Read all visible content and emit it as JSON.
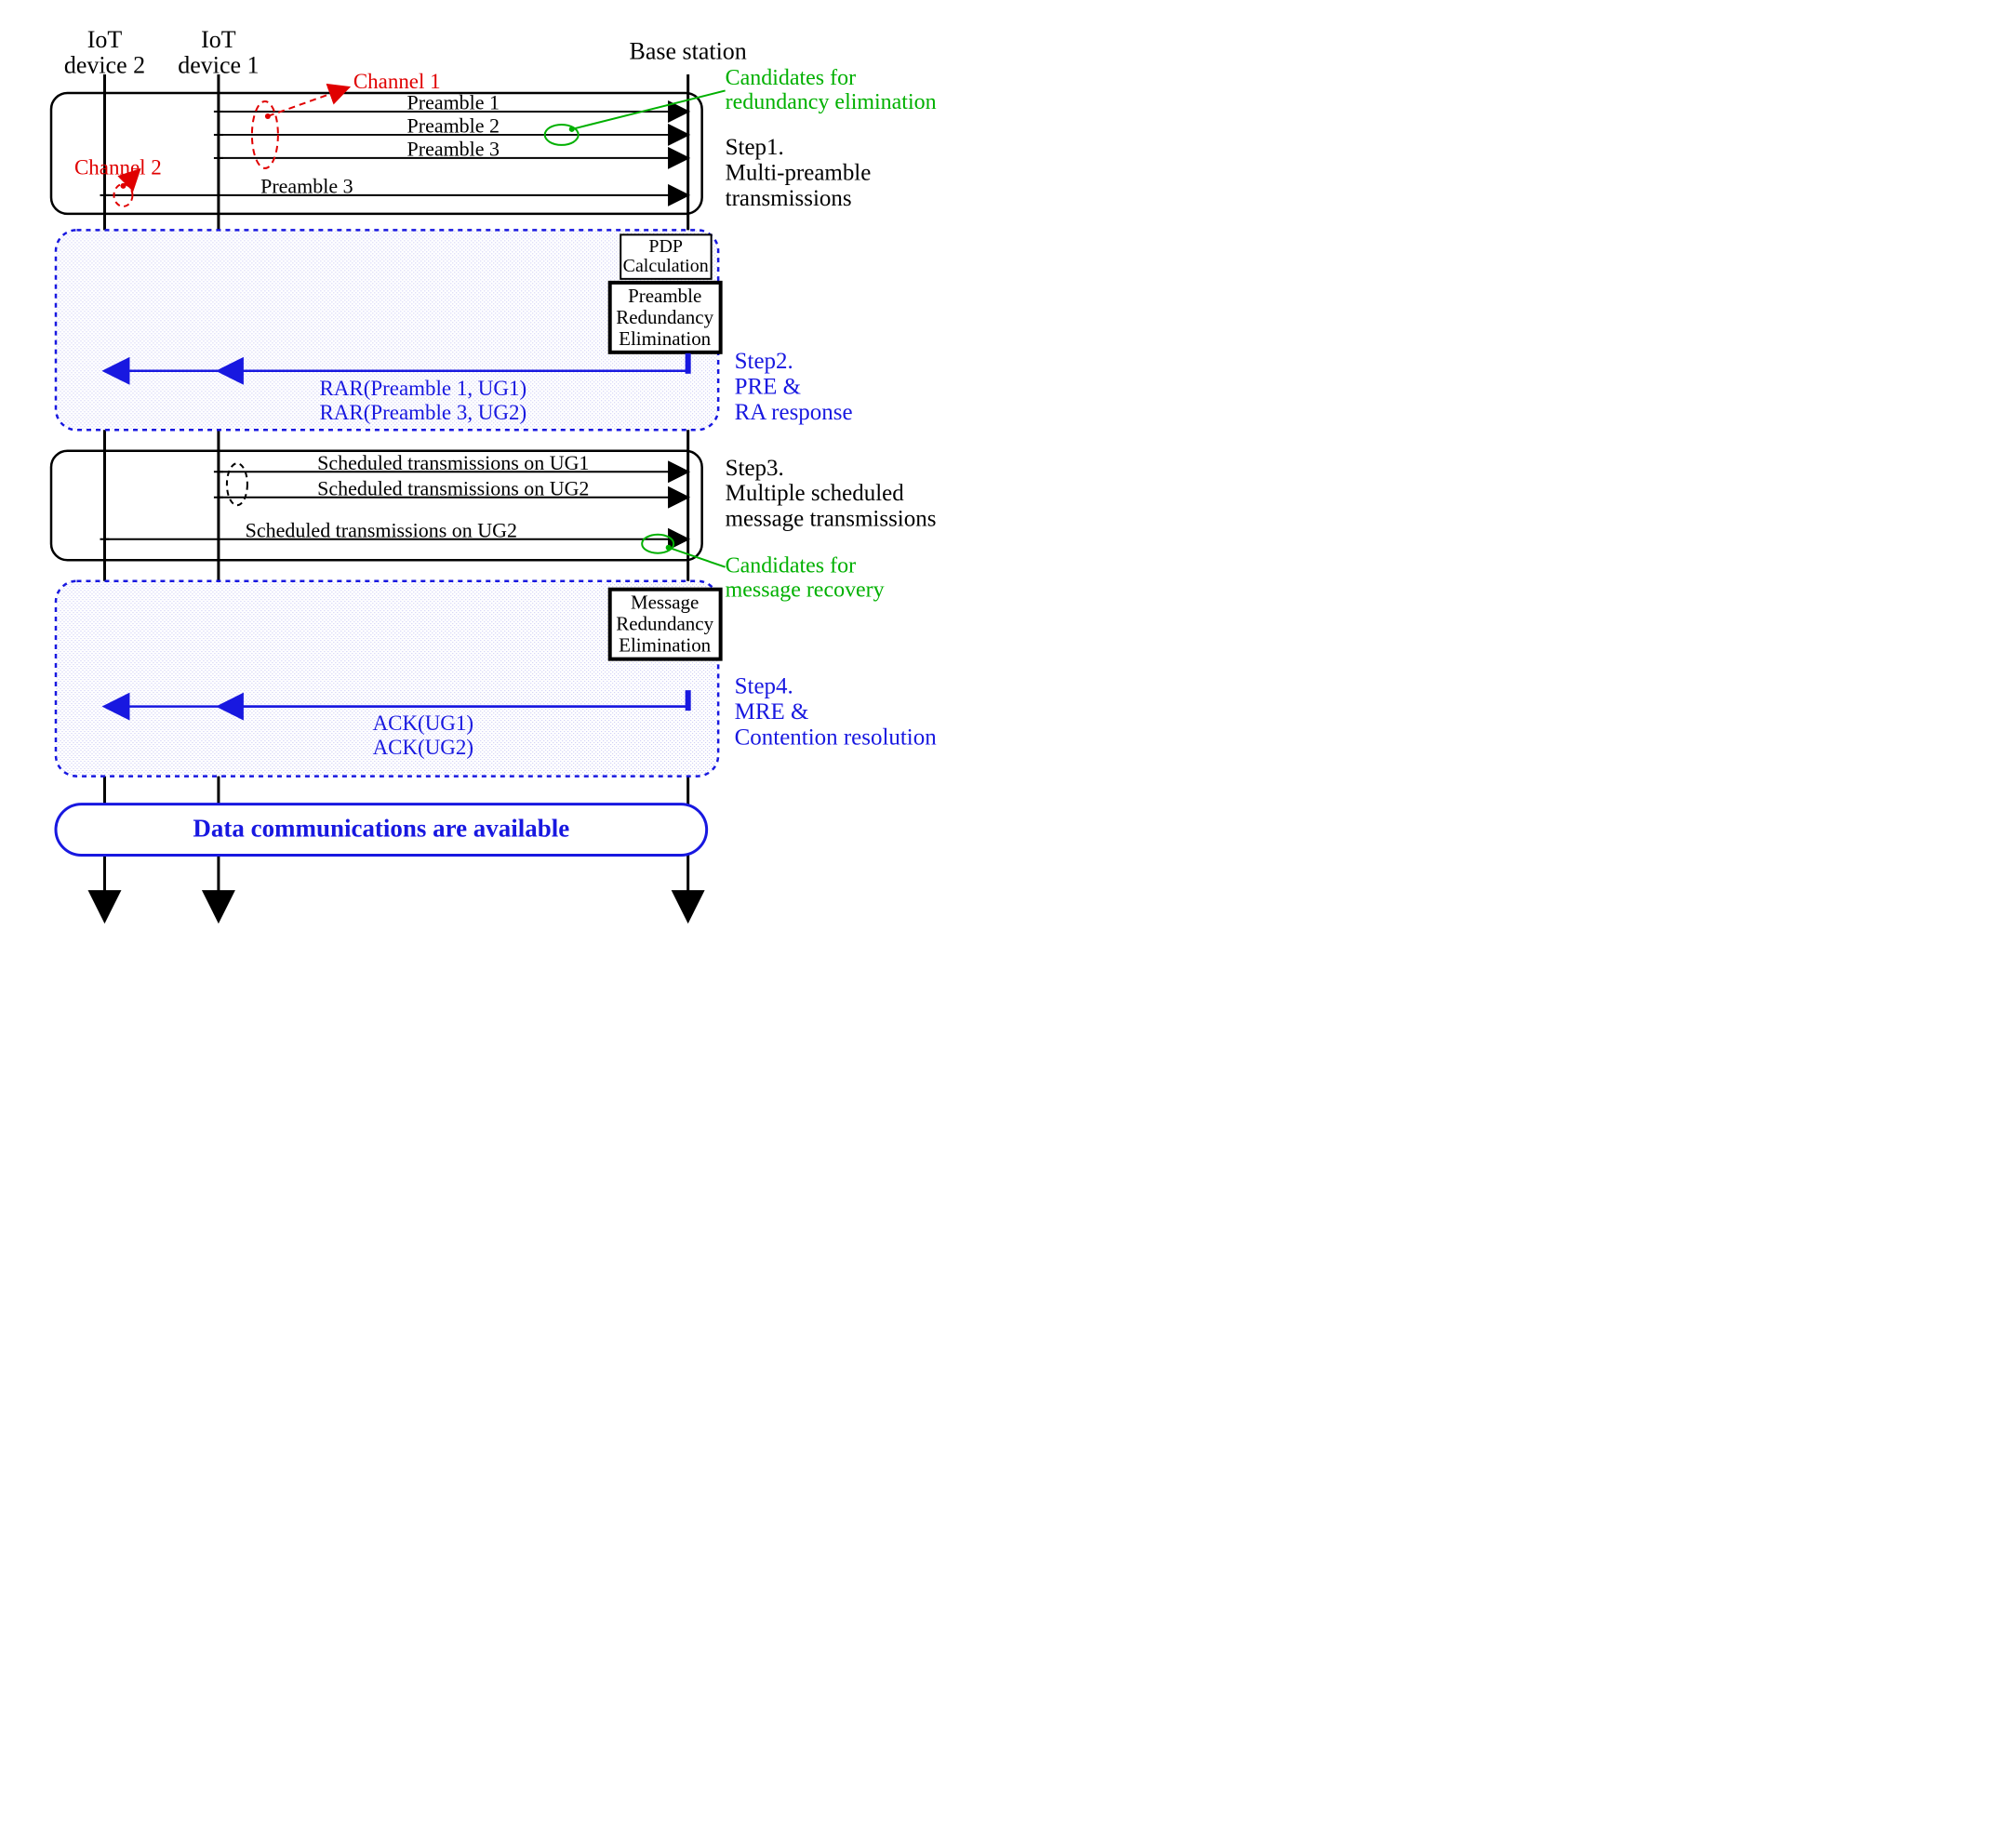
{
  "actors": {
    "device2": "IoT\ndevice 2",
    "device1": "IoT\ndevice 1",
    "base": "Base station"
  },
  "channels": {
    "ch1": "Channel 1",
    "ch2": "Channel 2"
  },
  "candidates": {
    "redundancy": "Candidates for\nredundancy elimination",
    "recovery": "Candidates for\nmessage recovery"
  },
  "step1": {
    "p1": "Preamble 1",
    "p2": "Preamble 2",
    "p3": "Preamble 3",
    "p3b": "Preamble 3",
    "label": "Step1.\nMulti-preamble\ntransmissions"
  },
  "step2": {
    "pdp": "PDP\nCalculation",
    "pre": "Preamble\nRedundancy\nElimination",
    "rar1": "RAR(Preamble 1, UG1)",
    "rar2": "RAR(Preamble 3, UG2)",
    "label": "Step2.\nPRE &\nRA response"
  },
  "step3": {
    "s1": "Scheduled transmissions on UG1",
    "s2": "Scheduled transmissions on UG2",
    "s3": "Scheduled transmissions on UG2",
    "label": "Step3.\nMultiple scheduled\nmessage transmissions"
  },
  "step4": {
    "mre": "Message\nRedundancy\nElimination",
    "ack1": "ACK(UG1)",
    "ack2": "ACK(UG2)",
    "label": "Step4.\nMRE &\nContention resolution"
  },
  "footer": "Data communications are available"
}
